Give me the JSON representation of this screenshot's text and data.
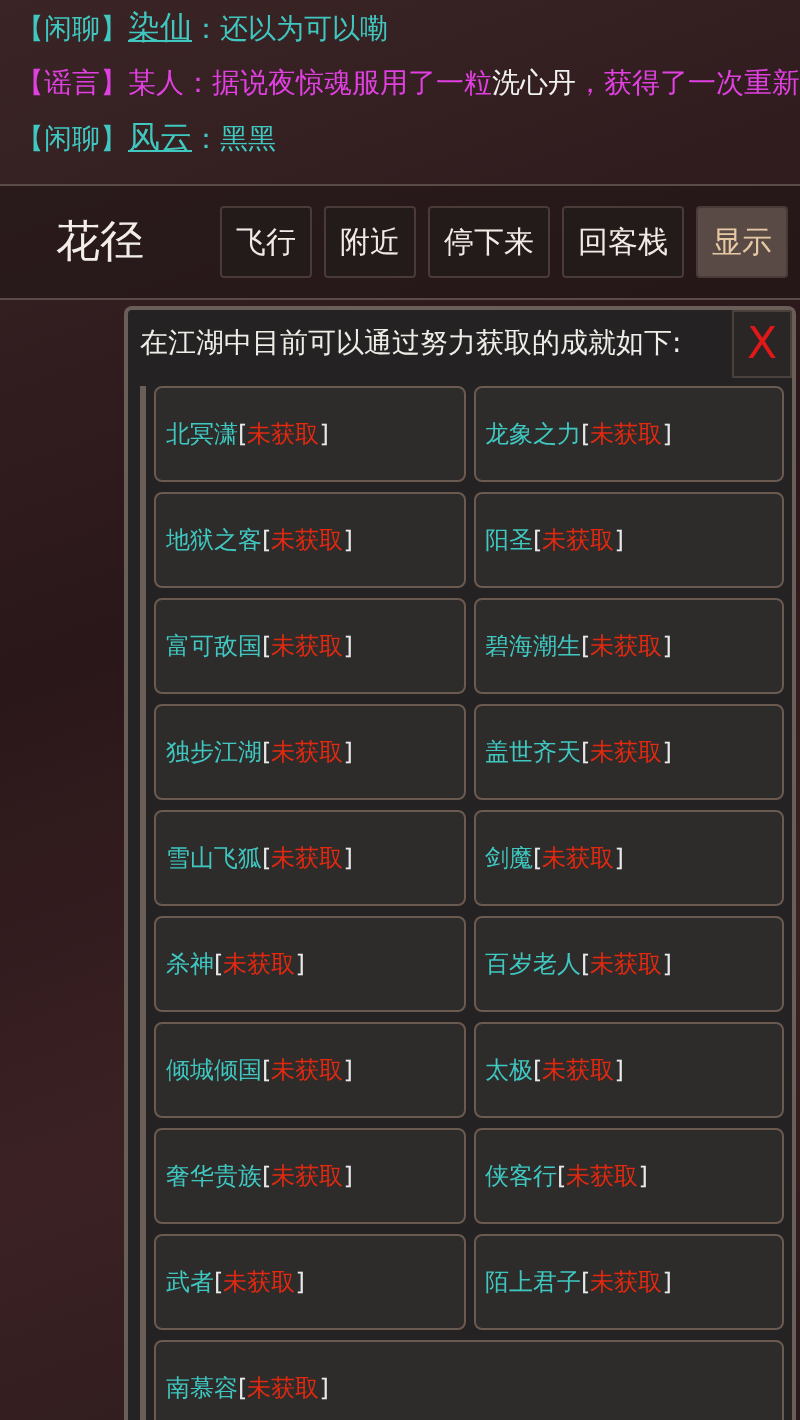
{
  "chat": [
    {
      "channel": "【闲聊】",
      "kind": "chat",
      "speaker": "染仙",
      "colon": "：",
      "parts": [
        {
          "text": "还以为可以嘞",
          "highlight": false
        }
      ]
    },
    {
      "channel": "【谣言】",
      "kind": "rumor",
      "speaker": "某人",
      "colon": "：",
      "parts": [
        {
          "text": "据说夜惊魂服用了一粒",
          "highlight": false
        },
        {
          "text": "洗心丹",
          "highlight": true
        },
        {
          "text": "，获得了一次重新",
          "highlight": false
        }
      ]
    },
    {
      "channel": "【闲聊】",
      "kind": "chat",
      "speaker": "风云",
      "colon": "：",
      "parts": [
        {
          "text": "黑黑",
          "highlight": false
        }
      ]
    }
  ],
  "location": "花径",
  "buttons": [
    {
      "label": "飞行",
      "selected": false
    },
    {
      "label": "附近",
      "selected": false
    },
    {
      "label": "停下来",
      "selected": false
    },
    {
      "label": "回客栈",
      "selected": false
    },
    {
      "label": "显示",
      "selected": true
    }
  ],
  "dialog": {
    "title": "在江湖中目前可以通过努力获取的成就如下:",
    "close": "X",
    "achievements": [
      {
        "name": "北冥潇",
        "status": "[未获取]",
        "obtained": false
      },
      {
        "name": "龙象之力",
        "status": "[未获取]",
        "obtained": false
      },
      {
        "name": "地狱之客",
        "status": "[未获取]",
        "obtained": false
      },
      {
        "name": "阳圣",
        "status": "[未获取]",
        "obtained": false
      },
      {
        "name": "富可敌国",
        "status": "[未获取]",
        "obtained": false
      },
      {
        "name": "碧海潮生",
        "status": "[未获取]",
        "obtained": false
      },
      {
        "name": "独步江湖",
        "status": "[未获取]",
        "obtained": false
      },
      {
        "name": "盖世齐天",
        "status": "[未获取]",
        "obtained": false
      },
      {
        "name": "雪山飞狐",
        "status": "[未获取]",
        "obtained": false
      },
      {
        "name": "剑魔",
        "status": "[未获取]",
        "obtained": false
      },
      {
        "name": "杀神",
        "status": "[未获取]",
        "obtained": false
      },
      {
        "name": "百岁老人",
        "status": "[未获取]",
        "obtained": false
      },
      {
        "name": "倾城倾国",
        "status": "[未获取]",
        "obtained": false
      },
      {
        "name": "太极",
        "status": "[未获取]",
        "obtained": false
      },
      {
        "name": "奢华贵族",
        "status": "[未获取]",
        "obtained": false
      },
      {
        "name": "侠客行",
        "status": "[未获取]",
        "obtained": false
      },
      {
        "name": "武者",
        "status": "[未获取]",
        "obtained": false
      },
      {
        "name": "陌上君子",
        "status": "[未获取]",
        "obtained": false
      },
      {
        "name": "南慕容",
        "status": "[未获取]",
        "obtained": false
      }
    ]
  }
}
